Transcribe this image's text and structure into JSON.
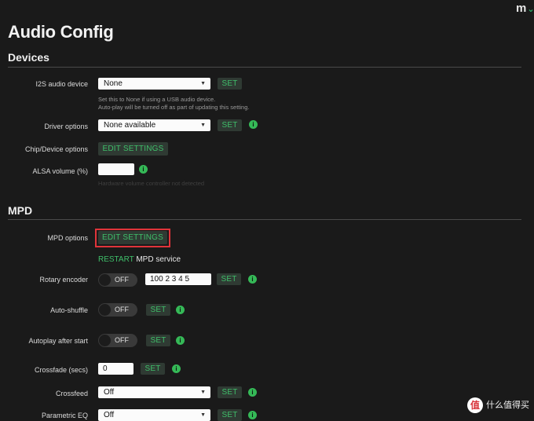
{
  "header": {
    "logo_text": "m",
    "logo_chevron": "⌄",
    "title": "Audio Config"
  },
  "devices": {
    "section_title": "Devices",
    "i2s": {
      "label": "I2S audio device",
      "value": "None",
      "set_label": "SET",
      "help_line1": "Set this to None if using a USB audio device.",
      "help_line2": "Auto-play will be turned off as part of updating this setting."
    },
    "driver": {
      "label": "Driver options",
      "value": "None available",
      "set_label": "SET"
    },
    "chip": {
      "label": "Chip/Device options",
      "button_label": "EDIT SETTINGS"
    },
    "alsa": {
      "label": "ALSA volume (%)",
      "value": "",
      "help": "Hardware volume controller not detected"
    }
  },
  "mpd": {
    "section_title": "MPD",
    "options": {
      "label": "MPD options",
      "button_label": "EDIT SETTINGS"
    },
    "restart": {
      "link_text": "RESTART",
      "rest_text": " MPD service"
    },
    "rotary": {
      "label": "Rotary encoder",
      "toggle_text": "OFF",
      "value": "100 2 3 4 5",
      "set_label": "SET"
    },
    "autoshuffle": {
      "label": "Auto-shuffle",
      "toggle_text": "OFF",
      "set_label": "SET"
    },
    "autoplay": {
      "label": "Autoplay after start",
      "toggle_text": "OFF",
      "set_label": "SET"
    },
    "crossfade": {
      "label": "Crossfade (secs)",
      "value": "0",
      "set_label": "SET"
    },
    "crossfeed": {
      "label": "Crossfeed",
      "value": "Off",
      "set_label": "SET"
    },
    "parametric": {
      "label": "Parametric EQ",
      "value": "Off",
      "set_label": "SET"
    }
  },
  "icons": {
    "info": "i",
    "arrow": "▼"
  },
  "colors": {
    "accent": "#3fbf6a",
    "highlight": "#e0343a",
    "background": "#1a1a1a"
  },
  "watermark": {
    "badge": "值",
    "text": "什么值得买"
  }
}
